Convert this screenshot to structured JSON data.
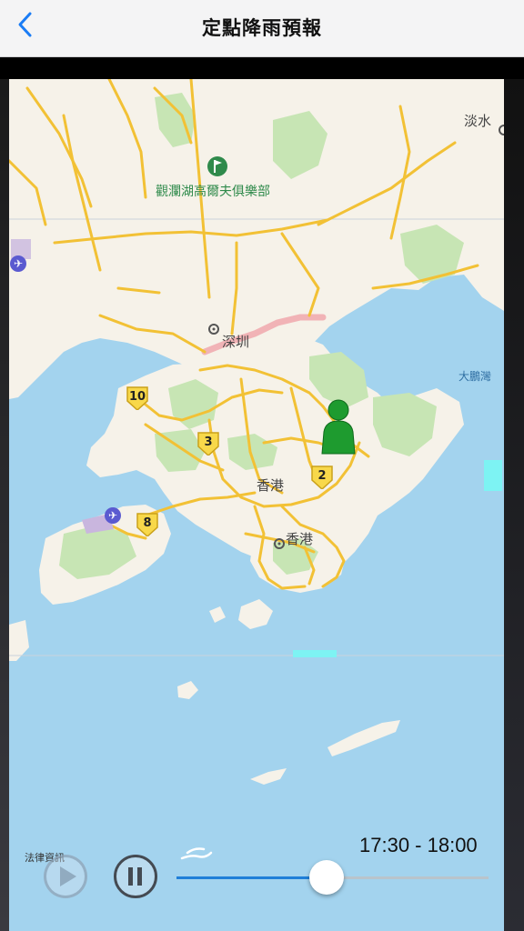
{
  "navbar": {
    "title": "定點降雨預報",
    "back_icon": "chevron-left-icon"
  },
  "map": {
    "places": {
      "tamshui": "淡水",
      "golf_club": "觀瀾湖高爾夫俱樂部",
      "shenzhen": "深圳",
      "mirs_bay": "大鵬灣",
      "hong_kong_north": "香港",
      "hong_kong_south": "香港"
    },
    "route_shields": [
      "10",
      "3",
      "2",
      "8"
    ],
    "icons": {
      "airport_north": "airplane-icon",
      "airport_south": "airplane-icon",
      "golf": "golf-icon",
      "location_marker": "person-marker-icon"
    },
    "colors": {
      "sea": "#a3d3ee",
      "land": "#f6f2e9",
      "park": "#c7e5b4",
      "road": "#f2c135",
      "border": "#f0a8ad",
      "marker": "#1e9b2f",
      "rain_echo": "#7df3f3"
    }
  },
  "controls": {
    "legal_link": "法律資訊",
    "time_range": "17:30 - 18:00",
    "play_icon": "play-icon",
    "pause_icon": "pause-icon",
    "slider_progress": 0.48
  }
}
